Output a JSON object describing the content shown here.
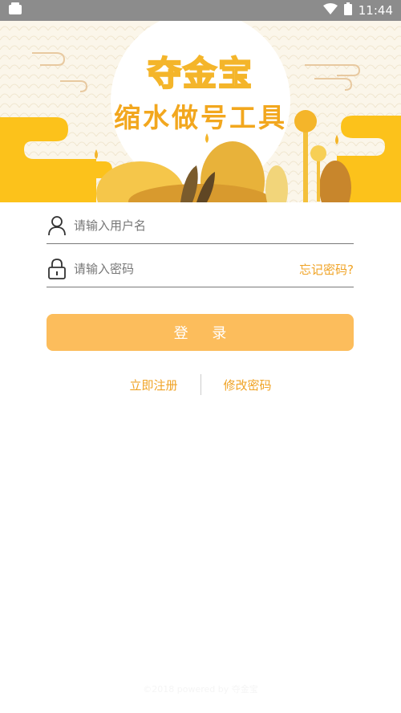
{
  "status_bar": {
    "time": "11:44"
  },
  "banner": {
    "title": "夺金宝",
    "subtitle": "缩水做号工具"
  },
  "login": {
    "username_placeholder": "请输入用户名",
    "password_placeholder": "请输入密码",
    "forgot_label": "忘记密码?",
    "submit_label": "登 录",
    "register_label": "立即注册",
    "change_password_label": "修改密码"
  },
  "footer": {
    "text": "©2018 powered by 夺金宝"
  },
  "colors": {
    "accent": "#f0a325",
    "button": "#fcbd5c",
    "status_bar": "#8c8c8c"
  }
}
